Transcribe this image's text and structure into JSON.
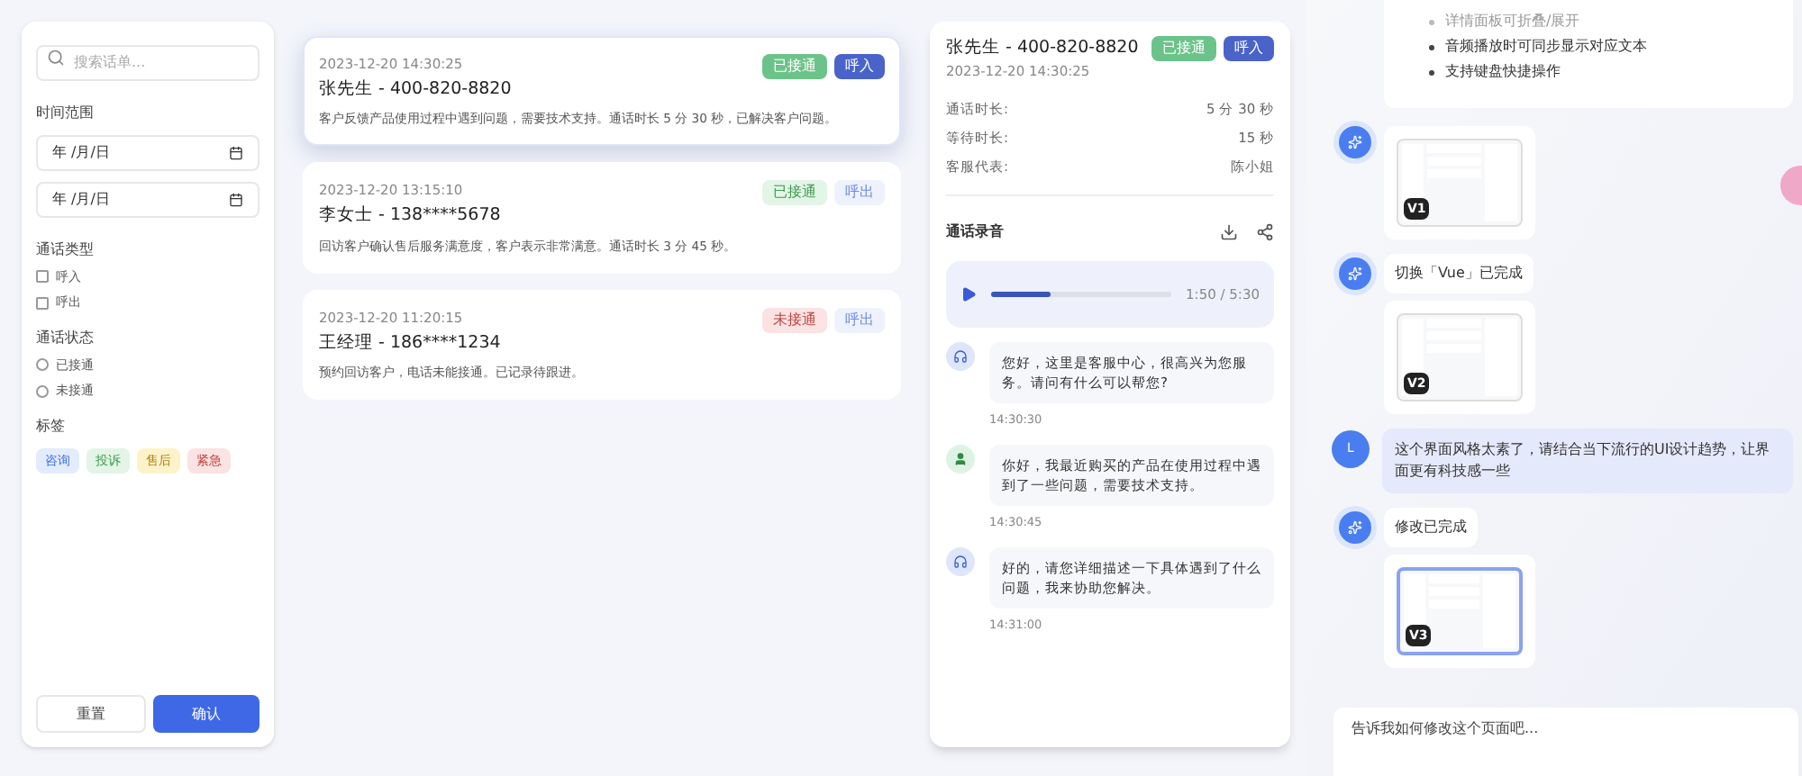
{
  "filters": {
    "search_placeholder": "搜索话单...",
    "time_range_label": "时间范围",
    "date_fields": [
      {
        "placeholder": "年 /月/日"
      },
      {
        "placeholder": "年 /月/日"
      }
    ],
    "call_type_label": "通话类型",
    "call_types": [
      {
        "label": "呼入",
        "checked": false
      },
      {
        "label": "呼出",
        "checked": false
      }
    ],
    "call_status_label": "通话状态",
    "call_statuses": [
      {
        "label": "已接通",
        "selected": false
      },
      {
        "label": "未接通",
        "selected": false
      }
    ],
    "tags_label": "标签",
    "tags": [
      {
        "label": "咨询",
        "color": "#3b6fe0"
      },
      {
        "label": "投诉",
        "color": "#3f9a4f"
      },
      {
        "label": "售后",
        "color": "#b07f10"
      },
      {
        "label": "紧急",
        "color": "#c0443f"
      }
    ],
    "buttons": {
      "reset": "重置",
      "confirm": "确认"
    }
  },
  "calls": [
    {
      "time": "2023-12-20 14:30:25",
      "title": "张先生 - 400-820-8820",
      "summary": "客户反馈产品使用过程中遇到问题，需要技术支持。通话时长 5 分 30 秒，已解决客户问题。",
      "status": {
        "label": "已接通",
        "kind": "connected"
      },
      "direction": {
        "label": "呼入",
        "kind": "in"
      },
      "selected": true
    },
    {
      "time": "2023-12-20 13:15:10",
      "title": "李女士 - 138****5678",
      "summary": "回访客户确认售后服务满意度，客户表示非常满意。通话时长 3 分 45 秒。",
      "status": {
        "label": "已接通",
        "kind": "connected"
      },
      "direction": {
        "label": "呼出",
        "kind": "out"
      },
      "selected": false
    },
    {
      "time": "2023-12-20 11:20:15",
      "title": "王经理 - 186****1234",
      "summary": "预约回访客户，电话未能接通。已记录待跟进。",
      "status": {
        "label": "未接通",
        "kind": "missed"
      },
      "direction": {
        "label": "呼出",
        "kind": "out"
      },
      "selected": false
    }
  ],
  "detail": {
    "title": "张先生 - 400-820-8820",
    "time": "2023-12-20 14:30:25",
    "status": {
      "label": "已接通",
      "kind": "connected"
    },
    "direction": {
      "label": "呼入",
      "kind": "in"
    },
    "stats": [
      {
        "label": "通话时长:",
        "value": "5 分 30 秒"
      },
      {
        "label": "等待时长:",
        "value": "15 秒"
      },
      {
        "label": "客服代表:",
        "value": "陈小姐"
      }
    ],
    "recording_label": "通话录音",
    "player": {
      "level": 0.33,
      "reading": "1:50 / 5:30"
    },
    "transcript": [
      {
        "kind": "agent",
        "text": "您好，这里是客服中心，很高兴为您服务。请问有什么可以帮您?",
        "time": "14:30:30"
      },
      {
        "kind": "customer",
        "text": "你好，我最近购买的产品在使用过程中遇到了一些问题，需要技术支持。",
        "time": "14:30:45"
      },
      {
        "kind": "agent",
        "text": "好的，请您详细描述一下具体遇到了什么问题，我来协助您解决。",
        "time": "14:31:00"
      }
    ]
  },
  "chat": {
    "bullets": [
      {
        "text": "详情面板可折叠/展开",
        "faded": true
      },
      {
        "text": "音频播放时可同步显示对应文本",
        "faded": false
      },
      {
        "text": "支持键盘快捷操作",
        "faded": false
      }
    ],
    "messages": [
      {
        "kind": "preview",
        "version": "V1",
        "selected": false
      },
      {
        "kind": "assistant_text",
        "text": "切换「Vue」已完成"
      },
      {
        "kind": "preview",
        "version": "V2",
        "selected": false
      },
      {
        "kind": "user_text",
        "avatar": "L",
        "text": "这个界面风格太素了，请结合当下流行的UI设计趋势，让界面更有科技感一些"
      },
      {
        "kind": "assistant_text",
        "text": "修改已完成"
      },
      {
        "kind": "preview",
        "version": "V3",
        "selected": true
      }
    ],
    "input_placeholder": "告诉我如何修改这个页面吧..."
  }
}
